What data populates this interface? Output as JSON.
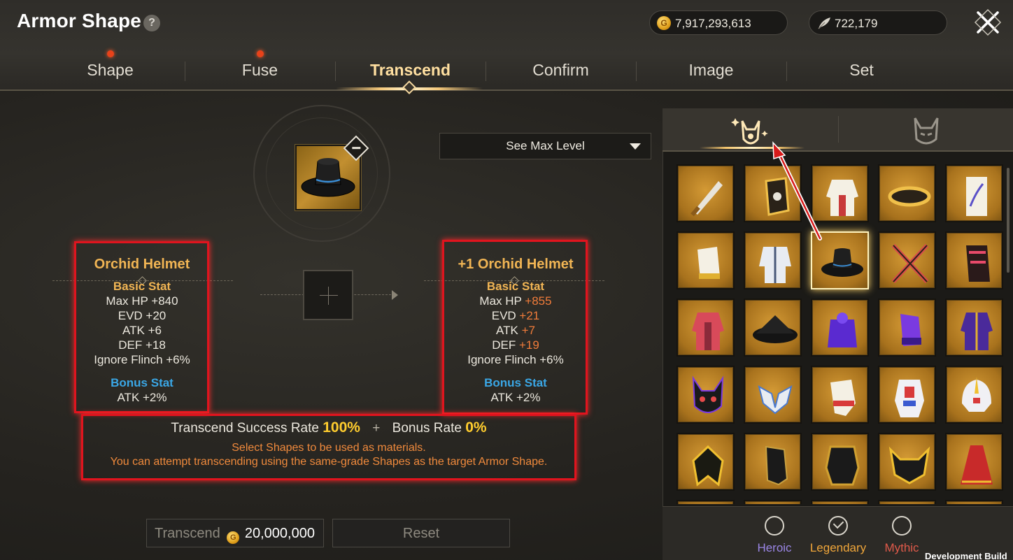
{
  "header": {
    "title": "Armor Shape",
    "help_symbol": "?",
    "gold_amount": "7,917,293,613",
    "gem_amount": "722,179"
  },
  "tabs": [
    {
      "label": "Shape",
      "notification": true
    },
    {
      "label": "Fuse",
      "notification": true
    },
    {
      "label": "Transcend",
      "active": true
    },
    {
      "label": "Confirm"
    },
    {
      "label": "Image"
    },
    {
      "label": "Set"
    }
  ],
  "max_level_dropdown": "See Max Level",
  "current_item": {
    "name": "Orchid Helmet",
    "basic_title": "Basic Stat",
    "basic": [
      "Max HP +840",
      "EVD +20",
      "ATK +6",
      "DEF +18",
      "Ignore Flinch +6%"
    ],
    "bonus_title": "Bonus Stat",
    "bonus": [
      "ATK +2%"
    ]
  },
  "next_item": {
    "name": "+1 Orchid Helmet",
    "basic_title": "Basic Stat",
    "basic": [
      {
        "label": "Max HP ",
        "value": "+855",
        "upgraded": true
      },
      {
        "label": "EVD ",
        "value": "+21",
        "upgraded": true
      },
      {
        "label": "ATK ",
        "value": "+7",
        "upgraded": true
      },
      {
        "label": "DEF ",
        "value": "+19",
        "upgraded": true
      },
      {
        "label": "Ignore Flinch ",
        "value": "+6%",
        "upgraded": false
      }
    ],
    "bonus_title": "Bonus Stat",
    "bonus": [
      "ATK +2%"
    ]
  },
  "rate": {
    "success_label": "Transcend Success Rate",
    "success_value": "100%",
    "plus": "+",
    "bonus_label": "Bonus Rate",
    "bonus_value": "0%",
    "hint1": "Select Shapes to be used as materials.",
    "hint2": "You can attempt transcending using the same-grade Shapes as the target Armor Shape."
  },
  "buttons": {
    "transcend_label": "Transcend",
    "transcend_cost": "20,000,000",
    "reset_label": "Reset"
  },
  "inventory": {
    "items": [
      "dagger",
      "gauntlet-gold",
      "white-robe",
      "gold-ring",
      "orchid-scroll",
      "white-gauntlet",
      "white-coat",
      "black-hat",
      "crossed-swords",
      "red-bracer",
      "red-armor",
      "straw-hat",
      "purple-armor",
      "purple-gauntlet",
      "purple-robe",
      "fox-mask",
      "white-shoulder",
      "white-glove",
      "mech-armor",
      "mech-helmet",
      "gold-wings",
      "black-gauntlet",
      "black-gold-armor",
      "horned-helmet",
      "red-cape"
    ],
    "selected_index": 7
  },
  "filters": [
    {
      "label": "Heroic",
      "checked": false,
      "color": "#9b86e6"
    },
    {
      "label": "Legendary",
      "checked": true,
      "color": "#f0a63a"
    },
    {
      "label": "Mythic",
      "checked": false,
      "color": "#e05a4a"
    }
  ],
  "footer_note": "Development Build"
}
